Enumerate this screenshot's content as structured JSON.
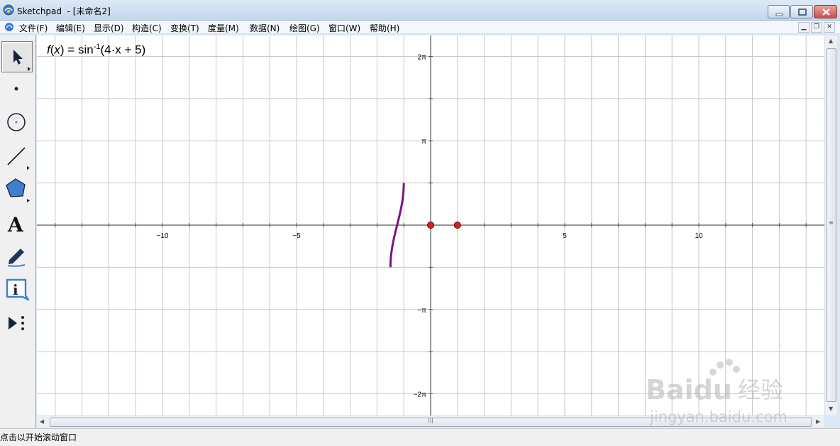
{
  "window": {
    "app_name": "Sketchpad",
    "doc_title": "  - [未命名2]"
  },
  "menu": [
    {
      "label": "文件(F)"
    },
    {
      "label": "编辑(E)"
    },
    {
      "label": "显示(D)"
    },
    {
      "label": "构造(C)"
    },
    {
      "label": "变换(T)"
    },
    {
      "label": "度量(M)"
    },
    {
      "label": "数据(N)"
    },
    {
      "label": "绘图(G)"
    },
    {
      "label": "窗口(W)"
    },
    {
      "label": "帮助(H)"
    }
  ],
  "tools": [
    {
      "name": "arrow-select-tool",
      "icon": "arrow-icon",
      "selected": true
    },
    {
      "name": "point-tool",
      "icon": "point-icon"
    },
    {
      "name": "compass-tool",
      "icon": "circle-icon"
    },
    {
      "name": "straightedge-tool",
      "icon": "line-icon"
    },
    {
      "name": "polygon-tool",
      "icon": "pentagon-icon"
    },
    {
      "name": "text-tool",
      "icon": "text-a-icon"
    },
    {
      "name": "marker-tool",
      "icon": "marker-icon"
    },
    {
      "name": "information-tool",
      "icon": "info-icon"
    },
    {
      "name": "custom-tool",
      "icon": "play-more-icon"
    }
  ],
  "text_tool_glyph": "A",
  "info_tool_glyph": "i",
  "function": {
    "name": "f",
    "var": "x",
    "eq": " = sin",
    "exp": "-1",
    "arg": "(4·x + 5)"
  },
  "axes": {
    "x_tick_labels": [
      {
        "value": -10,
        "text": "−10"
      },
      {
        "value": -5,
        "text": "−5"
      },
      {
        "value": 5,
        "text": "5"
      },
      {
        "value": 10,
        "text": "10"
      }
    ],
    "y_tick_labels": [
      {
        "value": 6.2832,
        "text": "2π"
      },
      {
        "value": 3.1416,
        "text": "π"
      },
      {
        "value": -3.1416,
        "text": "−π"
      },
      {
        "value": -6.2832,
        "text": "−2π"
      }
    ],
    "x_range": [
      -14.7,
      14.7
    ],
    "y_range": [
      -7.2,
      7.2
    ],
    "grid": true
  },
  "points": [
    {
      "name": "origin-point",
      "x": 0,
      "y": 0
    },
    {
      "name": "unit-point",
      "x": 1,
      "y": 0
    }
  ],
  "curve": {
    "color": "#7b1382",
    "x_from": -1.5,
    "x_to": -1.0
  },
  "colors": {
    "point_fill": "#e31b1b",
    "grid": "#c8c8c8",
    "axis": "#555555"
  },
  "status": {
    "text": "点击以开始滚动窗口"
  },
  "watermark": {
    "brand": "Baidu",
    "brand_cn": "经验",
    "url": "jingyan.baidu.com"
  }
}
